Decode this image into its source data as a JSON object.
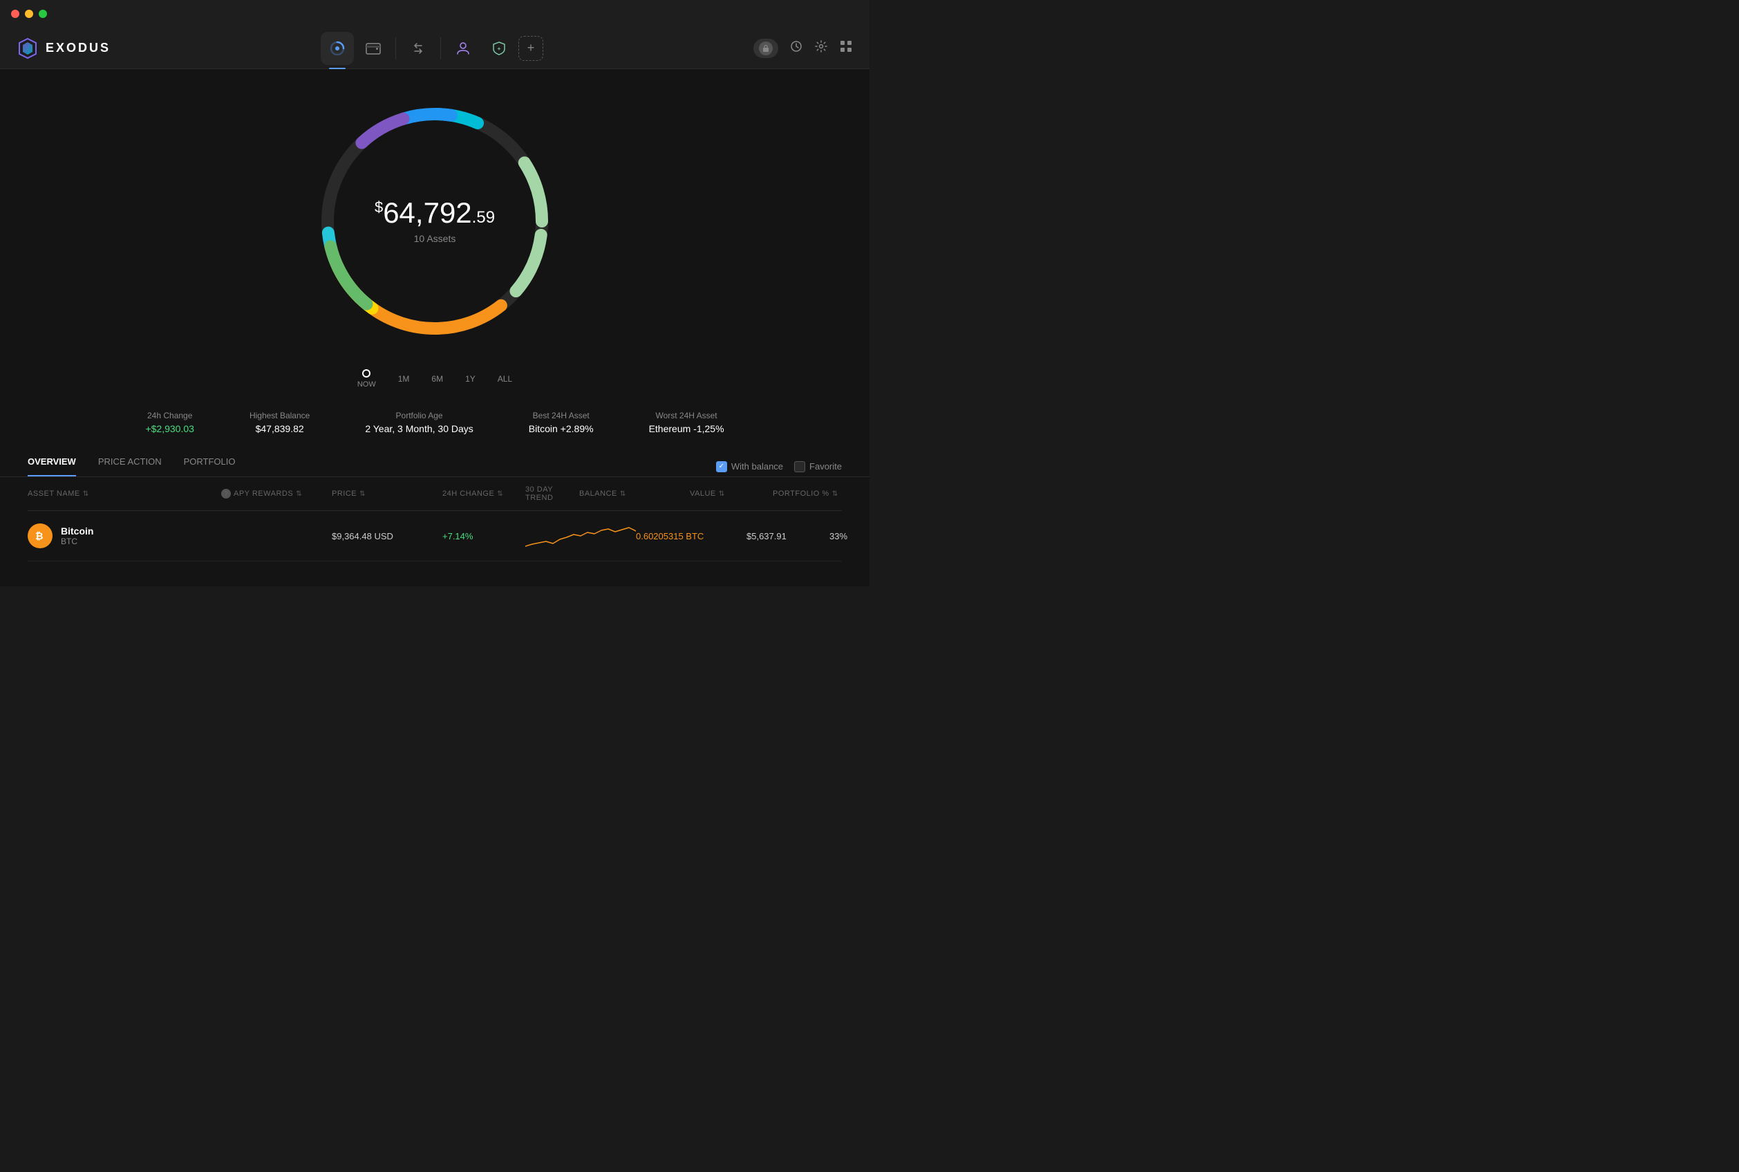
{
  "titleBar": {
    "buttons": [
      "close",
      "minimize",
      "maximize"
    ]
  },
  "header": {
    "logo": {
      "text": "EXODUS"
    },
    "navItems": [
      {
        "id": "portfolio",
        "label": "Portfolio",
        "active": true
      },
      {
        "id": "wallet",
        "label": "Wallet",
        "active": false
      },
      {
        "id": "exchange",
        "label": "Exchange",
        "active": false
      },
      {
        "id": "nft",
        "label": "NFT",
        "active": false
      },
      {
        "id": "earn",
        "label": "Earn",
        "active": false
      }
    ],
    "rightIcons": [
      "lock",
      "history",
      "settings",
      "grid"
    ]
  },
  "portfolio": {
    "totalAmount": "64,792",
    "totalCents": ".59",
    "currencySymbol": "$",
    "assetCount": "10 Assets",
    "timeline": {
      "periods": [
        "NOW",
        "1M",
        "6M",
        "1Y",
        "ALL"
      ]
    },
    "stats": [
      {
        "label": "24h Change",
        "value": "+$2,930.03",
        "type": "positive"
      },
      {
        "label": "Highest Balance",
        "value": "$47,839.82",
        "type": "normal"
      },
      {
        "label": "Portfolio Age",
        "value": "2 Year, 3 Month, 30 Days",
        "type": "normal"
      },
      {
        "label": "Best 24H Asset",
        "value": "Bitcoin +2.89%",
        "type": "normal"
      },
      {
        "label": "Worst 24H Asset",
        "value": "Ethereum -1,25%",
        "type": "normal"
      }
    ]
  },
  "tabs": {
    "items": [
      {
        "label": "OVERVIEW",
        "active": true
      },
      {
        "label": "PRICE ACTION",
        "active": false
      },
      {
        "label": "PORTFOLIO",
        "active": false
      }
    ],
    "filters": [
      {
        "label": "With balance",
        "checked": true
      },
      {
        "label": "Favorite",
        "checked": false
      }
    ]
  },
  "table": {
    "headers": [
      {
        "label": "ASSET NAME",
        "sortable": true
      },
      {
        "label": "APY REWARDS",
        "sortable": true,
        "hasInfo": true
      },
      {
        "label": "PRICE",
        "sortable": true
      },
      {
        "label": "24H CHANGE",
        "sortable": true
      },
      {
        "label": "30 DAY TREND",
        "sortable": false
      },
      {
        "label": "BALANCE",
        "sortable": true
      },
      {
        "label": "VALUE",
        "sortable": true
      },
      {
        "label": "PORTFOLIO %",
        "sortable": true
      }
    ],
    "rows": [
      {
        "name": "Bitcoin",
        "ticker": "BTC",
        "iconColor": "#f7931a",
        "iconEmoji": "₿",
        "apyRewards": "",
        "price": "$9,364.48 USD",
        "change24h": "+7.14%",
        "changeType": "positive",
        "balance": "0.60205315 BTC",
        "balanceHighlight": true,
        "value": "$5,637.91",
        "portfolio": "33%"
      }
    ]
  }
}
